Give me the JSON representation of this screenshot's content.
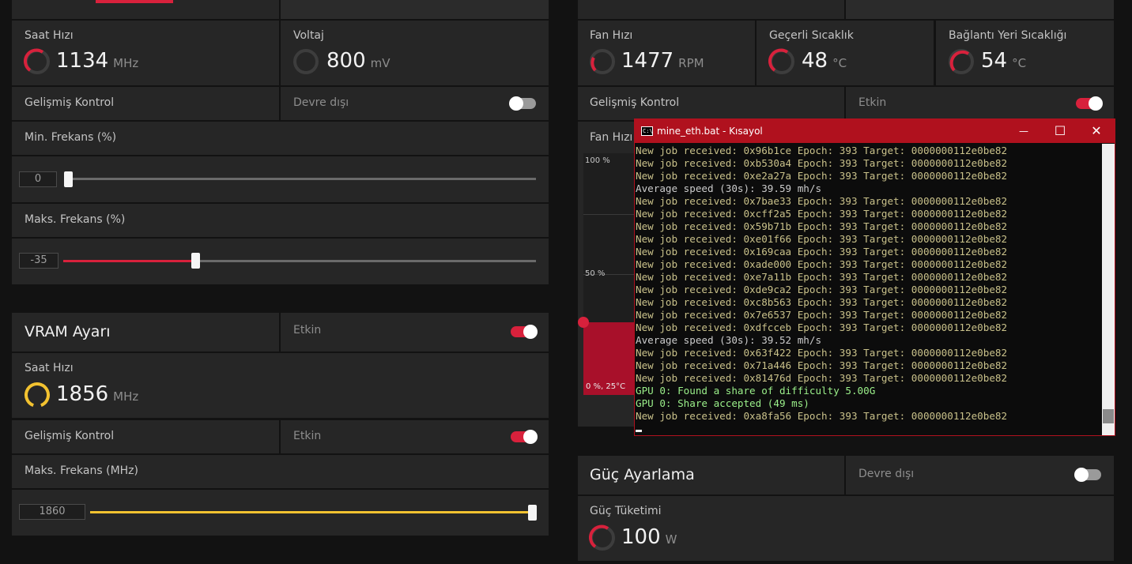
{
  "gpu": {
    "clock": {
      "label": "Saat Hızı",
      "value": "1134",
      "unit": "MHz"
    },
    "voltage": {
      "label": "Voltaj",
      "value": "800",
      "unit": "mV"
    },
    "advanced": {
      "label": "Gelişmiş Kontrol",
      "state": "Devre dışı"
    },
    "min_freq": {
      "label": "Min. Frekans (%)",
      "value": "0",
      "fraction": 0.0
    },
    "max_freq": {
      "label": "Maks. Frekans (%)",
      "value": "-35",
      "fraction": 0.28
    }
  },
  "vram": {
    "title": "VRAM Ayarı",
    "state": "Etkin",
    "clock": {
      "label": "Saat Hızı",
      "value": "1856",
      "unit": "MHz"
    },
    "advanced": {
      "label": "Gelişmiş Kontrol",
      "state": "Etkin"
    },
    "max_freq": {
      "label": "Maks. Frekans (MHz)",
      "value": "1860",
      "fraction": 1.0
    }
  },
  "fan": {
    "speed": {
      "label": "Fan Hızı",
      "value": "1477",
      "unit": "RPM"
    },
    "temp": {
      "label": "Geçerli Sıcaklık",
      "value": "48",
      "unit": "°C"
    },
    "junction": {
      "label": "Bağlantı Yeri Sıcaklığı",
      "value": "54",
      "unit": "°C"
    },
    "advanced": {
      "label": "Gelişmiş Kontrol",
      "state": "Etkin"
    },
    "curve_label": "Fan Hızı",
    "axis_100": "100 %",
    "axis_50": "50 %",
    "point_label": "0 %, 25°C"
  },
  "power": {
    "title": "Güç Ayarlama",
    "state": "Devre dışı",
    "consumption": {
      "label": "Güç Tüketimi",
      "value": "100",
      "unit": "W"
    }
  },
  "console": {
    "title": "mine_eth.bat - Kısayol",
    "icon_text": "C:\\",
    "minimize": "—",
    "maximize": "☐",
    "close": "✕",
    "lines": [
      {
        "kind": "job",
        "text": "New job received: 0x96b1ce Epoch: 393 Target: 0000000112e0be82"
      },
      {
        "kind": "job",
        "text": "New job received: 0xb530a4 Epoch: 393 Target: 0000000112e0be82"
      },
      {
        "kind": "job",
        "text": "New job received: 0xe2a27a Epoch: 393 Target: 0000000112e0be82"
      },
      {
        "kind": "avg",
        "text": "Average speed (30s): 39.59 mh/s"
      },
      {
        "kind": "job",
        "text": "New job received: 0x7bae33 Epoch: 393 Target: 0000000112e0be82"
      },
      {
        "kind": "job",
        "text": "New job received: 0xcff2a5 Epoch: 393 Target: 0000000112e0be82"
      },
      {
        "kind": "job",
        "text": "New job received: 0x59b71b Epoch: 393 Target: 0000000112e0be82"
      },
      {
        "kind": "job",
        "text": "New job received: 0xe01f66 Epoch: 393 Target: 0000000112e0be82"
      },
      {
        "kind": "job",
        "text": "New job received: 0x169caa Epoch: 393 Target: 0000000112e0be82"
      },
      {
        "kind": "job",
        "text": "New job received: 0xade000 Epoch: 393 Target: 0000000112e0be82"
      },
      {
        "kind": "job",
        "text": "New job received: 0xe7a11b Epoch: 393 Target: 0000000112e0be82"
      },
      {
        "kind": "job",
        "text": "New job received: 0xde9ca2 Epoch: 393 Target: 0000000112e0be82"
      },
      {
        "kind": "job",
        "text": "New job received: 0xc8b563 Epoch: 393 Target: 0000000112e0be82"
      },
      {
        "kind": "job",
        "text": "New job received: 0x7e6537 Epoch: 393 Target: 0000000112e0be82"
      },
      {
        "kind": "job",
        "text": "New job received: 0xdfcceb Epoch: 393 Target: 0000000112e0be82"
      },
      {
        "kind": "avg",
        "text": "Average speed (30s): 39.52 mh/s"
      },
      {
        "kind": "job",
        "text": "New job received: 0x63f422 Epoch: 393 Target: 0000000112e0be82"
      },
      {
        "kind": "job",
        "text": "New job received: 0x71a446 Epoch: 393 Target: 0000000112e0be82"
      },
      {
        "kind": "job",
        "text": "New job received: 0x81476d Epoch: 393 Target: 0000000112e0be82"
      },
      {
        "kind": "gpu",
        "text": "GPU 0: Found a share of difficulty 5.00G"
      },
      {
        "kind": "gpu",
        "text": "GPU 0: Share accepted (49 ms)"
      },
      {
        "kind": "job",
        "text": "New job received: 0xa8fa56 Epoch: 393 Target: 0000000112e0be82"
      }
    ]
  },
  "colors": {
    "accent_red": "#d8213c",
    "accent_yellow": "#f2c230",
    "panel": "#262626",
    "console_border": "#b0111e"
  }
}
